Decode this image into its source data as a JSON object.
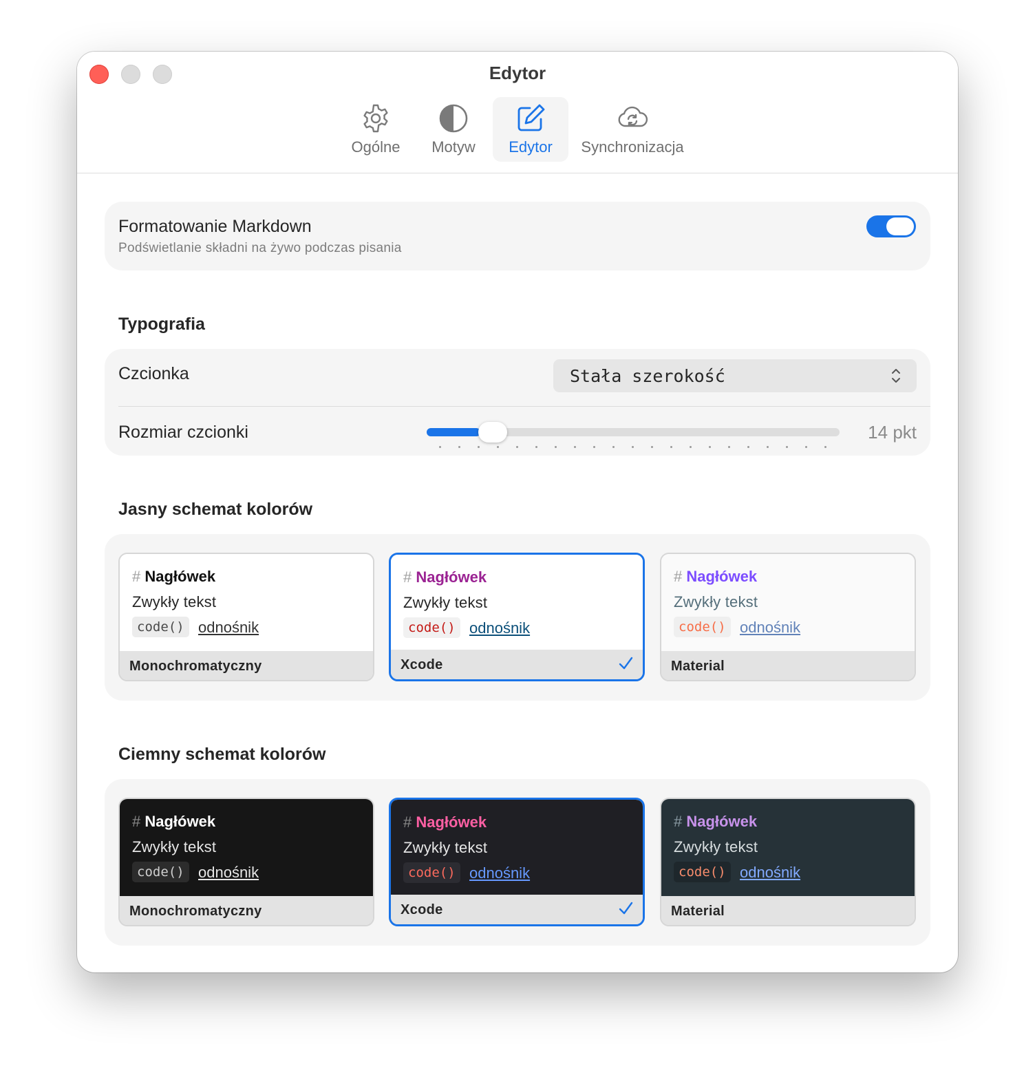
{
  "window": {
    "title": "Edytor"
  },
  "tabs": [
    {
      "label": "Ogólne",
      "icon": "gear-icon"
    },
    {
      "label": "Motyw",
      "icon": "half-circle-icon"
    },
    {
      "label": "Edytor",
      "icon": "edit-icon",
      "active": true
    },
    {
      "label": "Synchronizacja",
      "icon": "cloud-sync-icon"
    }
  ],
  "markdown": {
    "title": "Formatowanie Markdown",
    "subtitle": "Podświetlanie składni na żywo podczas pisania",
    "enabled": true
  },
  "typography": {
    "section_title": "Typografia",
    "font_label": "Czcionka",
    "font_value": "Stała szerokość",
    "size_label": "Rozmiar czcionki",
    "size_value": "14 pkt",
    "slider_fraction": 0.13
  },
  "light_schemes": {
    "section_title": "Jasny schemat kolorów",
    "cards": [
      {
        "hash": "#",
        "heading": "Nagłówek",
        "text": "Zwykły tekst",
        "code": "code()",
        "link": "odnośnik",
        "name": "Monochromatyczny",
        "selected": false,
        "colors": {
          "bg": "#ffffff",
          "hash": "#a0a0a0",
          "heading": "#111111",
          "text": "#262626",
          "code_bg": "#ececec",
          "code": "#4a4a4a",
          "link": "#333333"
        }
      },
      {
        "hash": "#",
        "heading": "Nagłówek",
        "text": "Zwykły tekst",
        "code": "code()",
        "link": "odnośnik",
        "name": "Xcode",
        "selected": true,
        "colors": {
          "bg": "#ffffff",
          "hash": "#a0a0a0",
          "heading": "#9b2393",
          "text": "#262626",
          "code_bg": "#f1f1f1",
          "code": "#c41a16",
          "link": "#0b4f79"
        }
      },
      {
        "hash": "#",
        "heading": "Nagłówek",
        "text": "Zwykły tekst",
        "code": "code()",
        "link": "odnośnik",
        "name": "Material",
        "selected": false,
        "colors": {
          "bg": "#fafafa",
          "hash": "#a0a0a0",
          "heading": "#7c4dff",
          "text": "#546e7a",
          "code_bg": "#efefef",
          "code": "#f76d47",
          "link": "#6182b8"
        }
      }
    ]
  },
  "dark_schemes": {
    "section_title": "Ciemny schemat kolorów",
    "cards": [
      {
        "hash": "#",
        "heading": "Nagłówek",
        "text": "Zwykły tekst",
        "code": "code()",
        "link": "odnośnik",
        "name": "Monochromatyczny",
        "selected": false,
        "colors": {
          "bg": "#161616",
          "hash": "#8a8a8a",
          "heading": "#ffffff",
          "text": "#e6e6e6",
          "code_bg": "#2c2c2c",
          "code": "#cfcfcf",
          "link": "#e6e6e6"
        }
      },
      {
        "hash": "#",
        "heading": "Nagłówek",
        "text": "Zwykły tekst",
        "code": "code()",
        "link": "odnośnik",
        "name": "Xcode",
        "selected": true,
        "colors": {
          "bg": "#1f1f24",
          "hash": "#8a8a8a",
          "heading": "#fc5fa3",
          "text": "#e6e6e6",
          "code_bg": "#2c2c32",
          "code": "#fc6a5d",
          "link": "#6699ff"
        }
      },
      {
        "hash": "#",
        "heading": "Nagłówek",
        "text": "Zwykły tekst",
        "code": "code()",
        "link": "odnośnik",
        "name": "Material",
        "selected": false,
        "colors": {
          "bg": "#263238",
          "hash": "#8a9aa3",
          "heading": "#c792ea",
          "text": "#d8dee0",
          "code_bg": "#1e272c",
          "code": "#f78c6c",
          "link": "#82aaff"
        }
      }
    ]
  },
  "accent_color": "#1a74e8"
}
